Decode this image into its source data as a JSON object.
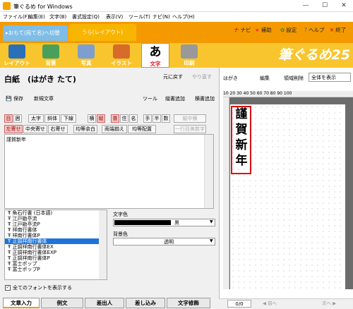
{
  "window": {
    "title": "筆ぐるめ for Windows",
    "minimize": "—",
    "maximize": "☐",
    "close": "✕"
  },
  "menu": [
    "ファイル(F)",
    "編集(E)",
    "文字(B)",
    "書式設定(Q)",
    "表示(V)",
    "ツール(T)",
    "ナビ(N)",
    "ヘルプ(H)"
  ],
  "tabs": {
    "front": "▸おもて(宛て名)へ切替",
    "back": "うら(レイアウト)"
  },
  "top_tools": [
    {
      "icon": "ナ",
      "label": "ナビ"
    },
    {
      "icon": "★",
      "label": "補助"
    },
    {
      "icon": "✿",
      "label": "設定"
    },
    {
      "icon": "?",
      "label": "ヘルプ"
    },
    {
      "icon": "✕",
      "label": "終了"
    }
  ],
  "big_tools": [
    {
      "label": "レイアウト",
      "color": "#2a6fb8"
    },
    {
      "label": "背景",
      "color": "#4aa05a"
    },
    {
      "label": "写真",
      "color": "#7c9fd0"
    },
    {
      "label": "イラスト",
      "color": "#d66b2a"
    },
    {
      "label": "文字",
      "glyph": "あ",
      "active": true
    },
    {
      "label": "印刷",
      "color": "#999999"
    }
  ],
  "brand": "筆ぐるめ25",
  "card_title": "白紙　(はがき たて)",
  "undo": "元に戻す",
  "redo": "やり直す",
  "save": "保存",
  "new_text": "新規文章",
  "tools_label": "ツール",
  "vertical_add": "縦書追加",
  "horizontal_add": "横書追加",
  "fmt_row1": [
    "目",
    "囲",
    "太字",
    "斜体",
    "下線",
    "横",
    "縦",
    "普",
    "住",
    "名",
    "手",
    "半",
    "数",
    "縦中横"
  ],
  "fmt_row2": [
    "左寄せ",
    "中央寄せ",
    "右寄せ",
    "均等余白",
    "両端揃え",
    "均等配置",
    "一行目美数字"
  ],
  "text_content": "謹賀新年",
  "fonts": [
    "魚石行書 (日本語)",
    "江戸勘亭流",
    "江戸勘亭流P",
    "祥南行書体",
    "祥南行書体P",
    "正調祥南行書体",
    "正調祥南行書体EX",
    "正調祥南行書体EXP",
    "正調祥南行書体P",
    "富士ポップ",
    "富士ポップP"
  ],
  "selected_font_index": 5,
  "text_color_label": "文字色",
  "text_color_name": "黒",
  "bg_color_label": "背景色",
  "bg_color_name": "透明",
  "show_all_fonts": "全てのフォントを表示する",
  "bottom_tabs": [
    "文章入力",
    "例文",
    "差出人",
    "差し込み",
    "文字修飾"
  ],
  "right": {
    "label": "はがき",
    "edit": "編集",
    "delete": "領域削除",
    "view": "全体を表示"
  },
  "ruler_numbers": "10  20  30  40  50  60  70  80  90  100",
  "vertical_text": "謹賀新年",
  "page": "0/0",
  "page_prev": "◀ 前へ",
  "page_next": "次へ ▶"
}
